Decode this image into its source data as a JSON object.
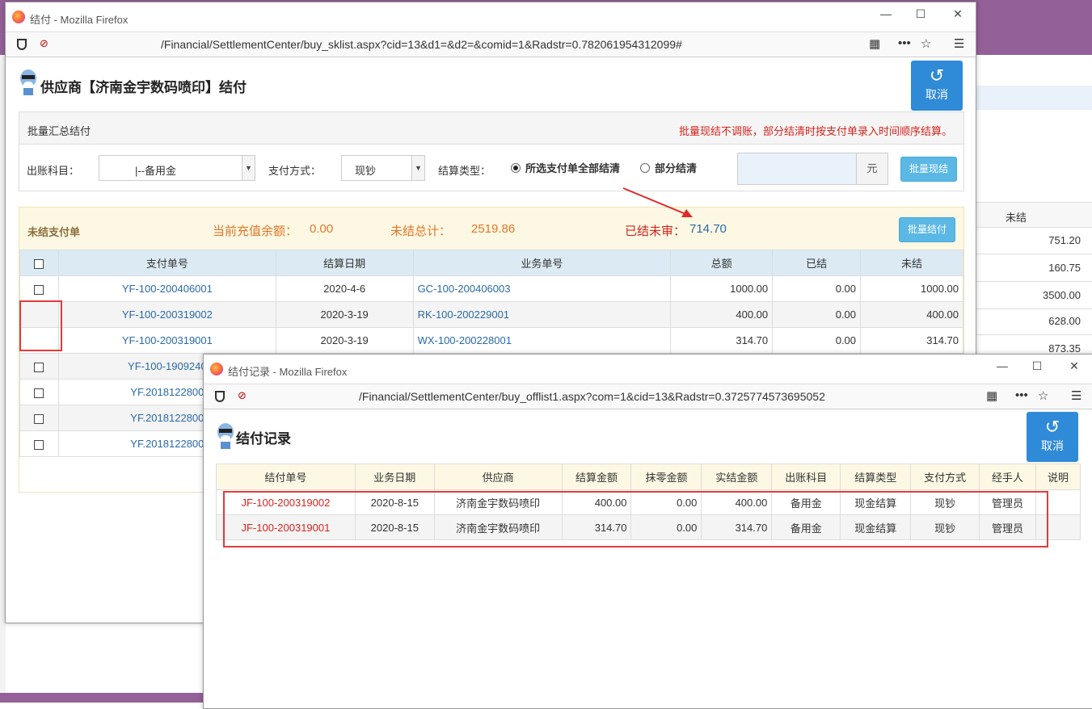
{
  "background": {
    "right_header": "未结",
    "right_values": [
      "751.20",
      "160.75",
      "3500.00",
      "628.00",
      "873.35"
    ]
  },
  "win1": {
    "title": "结付 - Mozilla Firefox",
    "url": "/Financial/SettlementCenter/buy_sklist.aspx?cid=13&d1=&d2=&comid=1&Radstr=0.782061954312099#",
    "page_title": "供应商【济南金宇数码喷印】结付",
    "cancel_label": "取消",
    "batch": {
      "header": "批量汇总结付",
      "notice": "批量现结不调账，部分结清时按支付单录入时间顺序结算。",
      "account_label": "出账科目：",
      "account_value": "|--备用金",
      "pay_label": "支付方式：",
      "pay_value": "现钞",
      "type_label": "结算类型：",
      "radio_all": "所选支付单全部结清",
      "radio_part": "部分结清",
      "unit": "元",
      "btn_cash": "批量现结"
    },
    "unsettled": {
      "title": "未结支付单",
      "balance_label": "当前充值余额：",
      "balance_value": "0.00",
      "total_label": "未结总计：",
      "total_value": "2519.86",
      "settled_label": "已结未审：",
      "settled_value": "714.70",
      "btn_batch": "批量结付"
    },
    "columns": [
      "支付单号",
      "结算日期",
      "业务单号",
      "总额",
      "已结",
      "未结"
    ],
    "rows": [
      {
        "no": "YF-100-200406001",
        "date": "2020-4-6",
        "biz": "GC-100-200406003",
        "total": "1000.00",
        "paid": "0.00",
        "unpaid": "1000.00",
        "cb": true
      },
      {
        "no": "YF-100-200319002",
        "date": "2020-3-19",
        "biz": "RK-100-200229001",
        "total": "400.00",
        "paid": "0.00",
        "unpaid": "400.00",
        "cb": false
      },
      {
        "no": "YF-100-200319001",
        "date": "2020-3-19",
        "biz": "WX-100-200228001",
        "total": "314.70",
        "paid": "0.00",
        "unpaid": "314.70",
        "cb": false
      },
      {
        "no": "YF-100-1909240",
        "cb": true
      },
      {
        "no": "YF.2018122800",
        "cb": true
      },
      {
        "no": "YF.2018122800",
        "cb": true
      },
      {
        "no": "YF.2018122800",
        "cb": true
      }
    ]
  },
  "win2": {
    "title": "结付记录 - Mozilla Firefox",
    "url": "/Financial/SettlementCenter/buy_offlist1.aspx?com=1&cid=13&Radstr=0.3725774573695052",
    "page_title": "结付记录",
    "cancel_label": "取消",
    "columns": [
      "结付单号",
      "业务日期",
      "供应商",
      "结算金额",
      "抹零金额",
      "实结金额",
      "出账科目",
      "结算类型",
      "支付方式",
      "经手人",
      "说明"
    ],
    "rows": [
      {
        "no": "JF-100-200319002",
        "date": "2020-8-15",
        "supplier": "济南金宇数码喷印",
        "amount": "400.00",
        "rounding": "0.00",
        "actual": "400.00",
        "account": "备用金",
        "type": "现金结算",
        "pay": "现钞",
        "handler": "管理员",
        "note": ""
      },
      {
        "no": "JF-100-200319001",
        "date": "2020-8-15",
        "supplier": "济南金宇数码喷印",
        "amount": "314.70",
        "rounding": "0.00",
        "actual": "314.70",
        "account": "备用金",
        "type": "现金结算",
        "pay": "现钞",
        "handler": "管理员",
        "note": ""
      }
    ]
  },
  "colors": {
    "accent": "#2f8ad7",
    "btn": "#5bb8e5",
    "warn": "#d6231e",
    "orange": "#e4762a"
  }
}
